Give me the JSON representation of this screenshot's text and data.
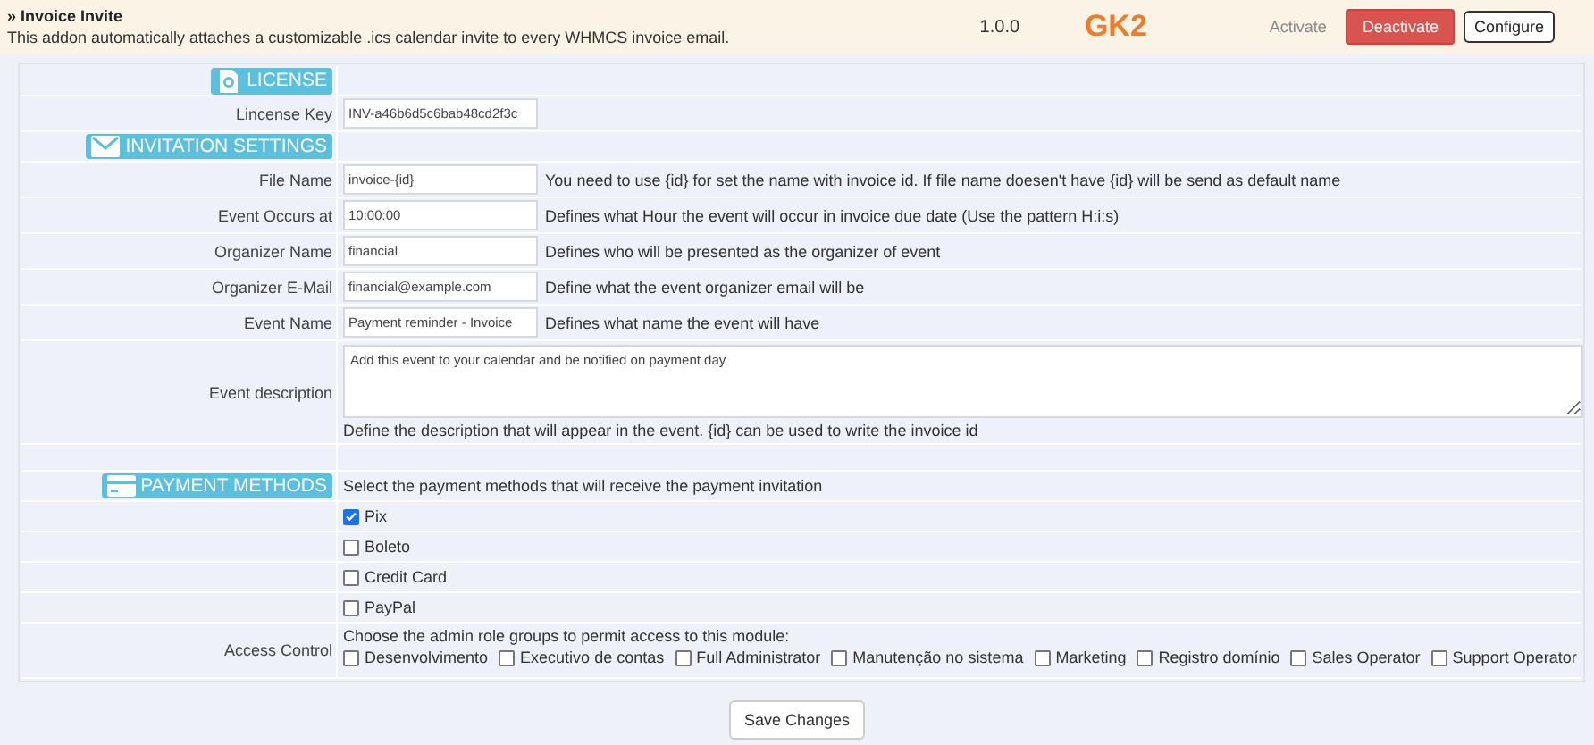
{
  "addon": {
    "title": "» Invoice Invite",
    "description": "This addon automatically attaches a customizable .ics calendar invite to every WHMCS invoice email.",
    "version": "1.0.0",
    "logo_text": "GK2",
    "actions": [
      {
        "label": "Activate",
        "kind": "link"
      },
      {
        "label": "Deactivate",
        "kind": "danger"
      },
      {
        "label": "Configure",
        "kind": "outline"
      }
    ]
  },
  "rows": [
    {
      "kind": "section",
      "title": "LICENSE"
    },
    {
      "kind": "input",
      "label": "Lincense Key",
      "value": "INV-a46b6d5c6bab48cd2f3c"
    },
    {
      "kind": "section",
      "title": "INVITATION SETTINGS"
    },
    {
      "kind": "input",
      "label": "File Name",
      "value": "invoice-{id}",
      "help": "You need to use {id} for set the name with invoice id. If file name doesen't have {id} will be send as default name"
    },
    {
      "kind": "input",
      "label": "Event Occurs at",
      "value": "10:00:00",
      "help": "Defines what Hour the event will occur in invoice due date (Use the pattern H:i:s)"
    },
    {
      "kind": "input",
      "label": "Organizer Name",
      "value": "financial",
      "help": "Defines who will be presented as the organizer of event"
    },
    {
      "kind": "input",
      "label": "Organizer E-Mail",
      "value": "financial@example.com",
      "help": "Define what the event organizer email will be"
    },
    {
      "kind": "input",
      "label": "Event Name",
      "value": "Payment reminder - Invoice",
      "help": "Defines what name the event will have"
    },
    {
      "kind": "textarea",
      "label": "Event description",
      "value": "Add this event to your calendar and be notified on payment day",
      "help": "Define the description that will appear in the event. {id} can be used to write the invoice id"
    },
    {
      "kind": "spacer"
    },
    {
      "kind": "section",
      "title": "PAYMENT METHODS",
      "note": "Select the payment methods that will receive the payment invitation"
    },
    {
      "kind": "checkbox",
      "label": "Pix",
      "checked": true
    },
    {
      "kind": "checkbox",
      "label": "Boleto",
      "checked": false
    },
    {
      "kind": "checkbox",
      "label": "Credit Card",
      "checked": false
    },
    {
      "kind": "checkbox",
      "label": "PayPal",
      "checked": false
    },
    {
      "kind": "checkgroup",
      "label": "Access Control",
      "note": "Choose the admin role groups to permit access to this module:",
      "options": [
        {
          "label": "Desenvolvimento",
          "checked": false
        },
        {
          "label": "Executivo de contas",
          "checked": false
        },
        {
          "label": "Full Administrator",
          "checked": false
        },
        {
          "label": "Manutenção no sistema",
          "checked": false
        },
        {
          "label": "Marketing",
          "checked": false
        },
        {
          "label": "Registro domínio",
          "checked": false
        },
        {
          "label": "Sales Operator",
          "checked": false
        },
        {
          "label": "Support Operator",
          "checked": false
        }
      ]
    }
  ],
  "save_button": "Save Changes"
}
